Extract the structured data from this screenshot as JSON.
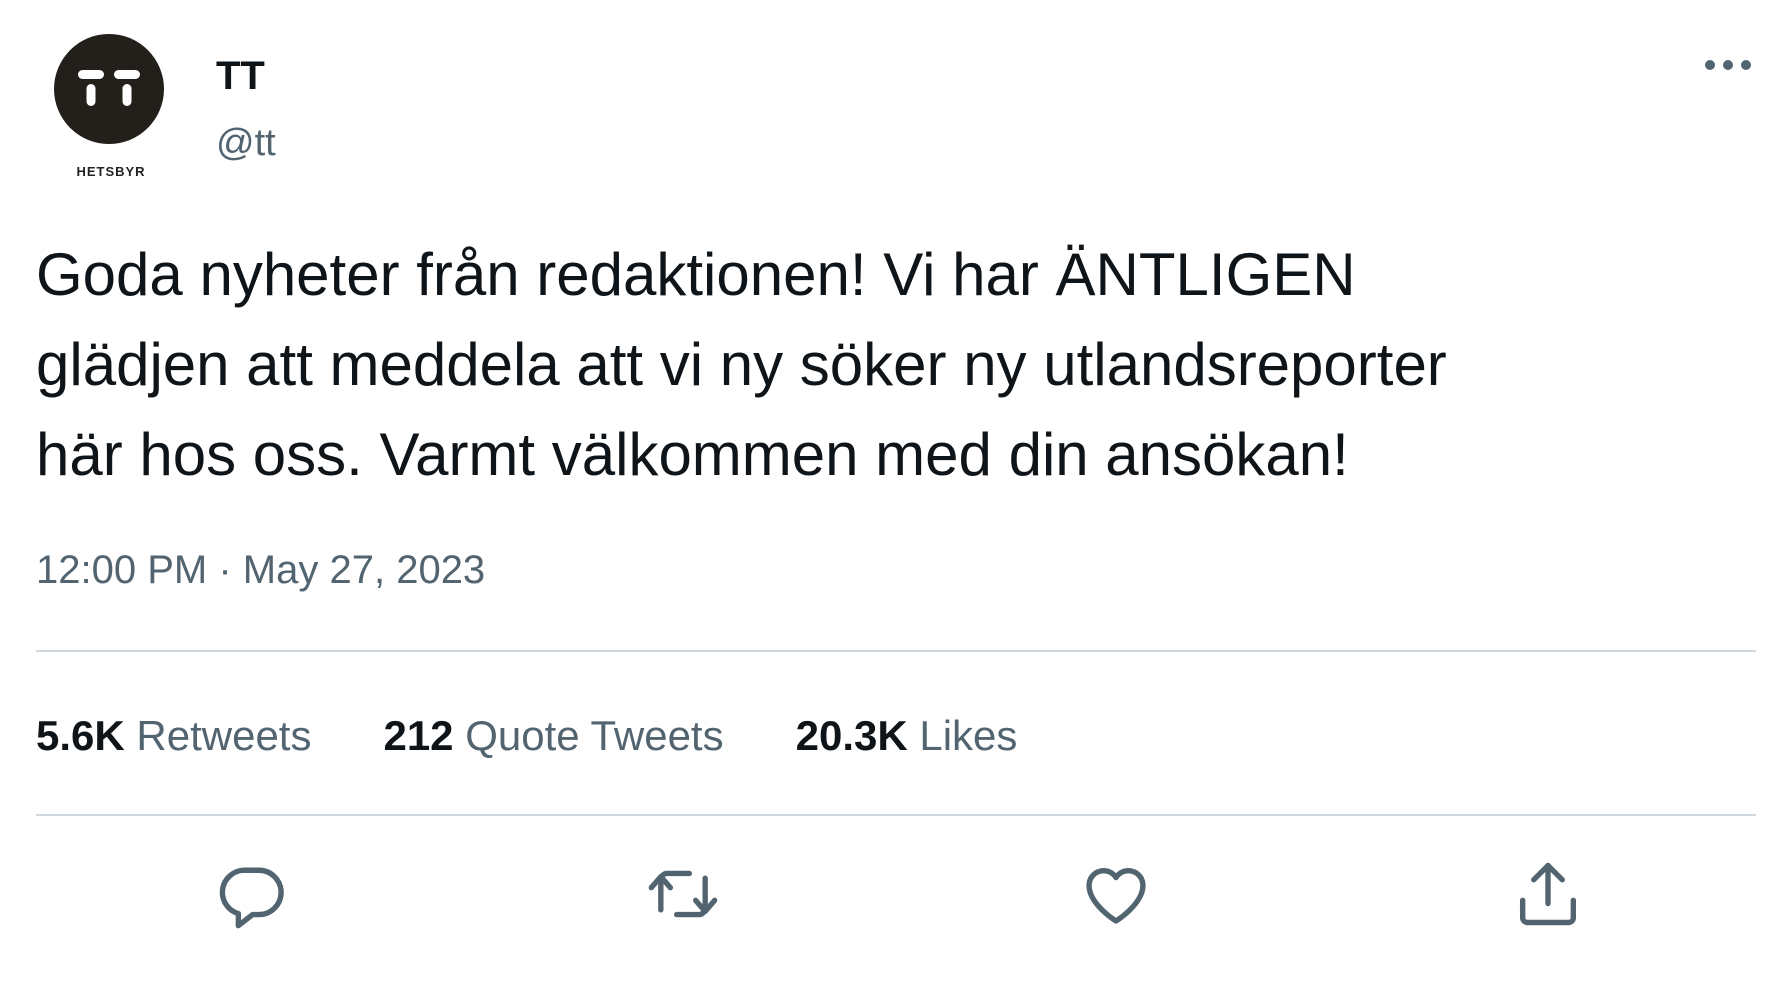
{
  "author": {
    "display_name": "TT",
    "handle": "@tt",
    "avatar_caption": "HETSBYR"
  },
  "tweet": {
    "line1": "Goda nyheter från redaktionen! Vi har ÄNTLIGEN",
    "line2": "glädjen att meddela att vi ny söker ny utlandsreporter",
    "line3": "här hos oss. Varmt välkommen med din ansökan!",
    "time": "12:00 PM",
    "separator": "·",
    "date": "May 27, 2023"
  },
  "stats": {
    "retweets_count": "5.6K",
    "retweets_label": "Retweets",
    "quotes_count": "212",
    "quotes_label": "Quote Tweets",
    "likes_count": "20.3K",
    "likes_label": "Likes"
  },
  "icons": {
    "more": "more-horizontal-icon",
    "reply": "reply-icon",
    "retweet": "retweet-icon",
    "like": "heart-icon",
    "share": "share-icon"
  },
  "colors": {
    "text_primary": "#0f1419",
    "text_secondary": "#536471",
    "divider": "#cfd9de",
    "avatar_bg": "#231f1a"
  }
}
